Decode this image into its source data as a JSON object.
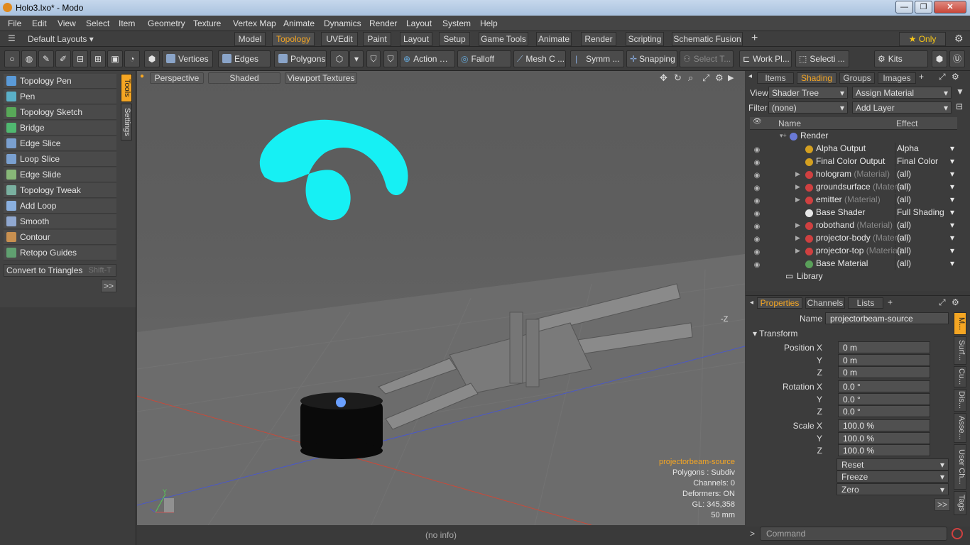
{
  "window": {
    "title": "Holo3.lxo* - Modo"
  },
  "menu": [
    "File",
    "Edit",
    "View",
    "Select",
    "Item",
    "Geometry",
    "Texture",
    "Vertex Map",
    "Animate",
    "Dynamics",
    "Render",
    "Layout",
    "System",
    "Help"
  ],
  "layouts": {
    "default": "Default Layouts ▾",
    "tabs": [
      "Model",
      "Topology",
      "UVEdit",
      "Paint",
      "Layout",
      "Setup",
      "Game Tools",
      "Animate",
      "Render",
      "Scripting",
      "Schematic Fusion"
    ],
    "active": "Topology",
    "only": "★ Only"
  },
  "toolbar": {
    "vertices": "Vertices",
    "edges": "Edges",
    "polygons": "Polygons",
    "action": "Action",
    "falloff": "Falloff",
    "meshc": "Mesh C ...",
    "symm": "Symm ...",
    "snapping": "Snapping",
    "selectt": "Select T...",
    "workpl": "Work Pl...",
    "selecti": "Selecti ...",
    "kits": "Kits"
  },
  "tools": [
    "Topology Pen",
    "Pen",
    "Topology Sketch",
    "Bridge",
    "Edge Slice",
    "Loop Slice",
    "Edge Slide",
    "Topology Tweak",
    "Add Loop",
    "Smooth",
    "Contour",
    "Retopo Guides"
  ],
  "tools_extra": {
    "convert": "Convert to Triangles",
    "shortcut": "Shift-T",
    "more": ">>"
  },
  "vtabs": {
    "tools": "Tools",
    "settings": "Settings"
  },
  "viewport": {
    "perspective": "Perspective",
    "shaded": "Shaded",
    "textures": "Viewport Textures",
    "axis": "-Z",
    "info": [
      "projectorbeam-source",
      "Polygons : Subdiv",
      "Channels: 0",
      "Deformers: ON",
      "GL: 345,358",
      "50 mm"
    ],
    "status": "(no info)",
    "gizmo_y": "Y"
  },
  "shading": {
    "tabs": [
      "Items",
      "Shading",
      "Groups",
      "Images"
    ],
    "active": "Shading",
    "view_label": "View",
    "view_value": "Shader Tree",
    "assign": "Assign Material",
    "filter_label": "Filter",
    "filter_value": "(none)",
    "addlayer": "Add Layer",
    "col_name": "Name",
    "col_effect": "Effect",
    "rows": [
      {
        "name": "Render",
        "sub": "",
        "effect": "",
        "ball": "#6a7ad8",
        "indent": 56
      },
      {
        "name": "Alpha Output",
        "sub": "",
        "effect": "Alpha",
        "ball": "#d4a020",
        "indent": 78
      },
      {
        "name": "Final Color Output",
        "sub": "",
        "effect": "Final Color",
        "ball": "#d4a020",
        "indent": 78
      },
      {
        "name": "hologram",
        "sub": " (Material)",
        "effect": "(all)",
        "ball": "#d04040",
        "indent": 78
      },
      {
        "name": "groundsurface",
        "sub": " (Material)",
        "effect": "(all)",
        "ball": "#d04040",
        "indent": 78
      },
      {
        "name": "emitter",
        "sub": " (Material)",
        "effect": "(all)",
        "ball": "#d04040",
        "indent": 78
      },
      {
        "name": "Base Shader",
        "sub": "",
        "effect": "Full Shading",
        "ball": "#e8e8e8",
        "indent": 78
      },
      {
        "name": "robothand",
        "sub": " (Material)",
        "effect": "(all)",
        "ball": "#d04040",
        "indent": 78
      },
      {
        "name": "projector-body",
        "sub": " (Material)",
        "effect": "(all)",
        "ball": "#d04040",
        "indent": 78
      },
      {
        "name": "projector-top",
        "sub": " (Material)",
        "effect": "(all)",
        "ball": "#d04040",
        "indent": 78
      },
      {
        "name": "Base Material",
        "sub": "",
        "effect": "(all)",
        "ball": "#5aa05a",
        "indent": 78
      }
    ],
    "library": "Library"
  },
  "properties": {
    "tabs": [
      "Properties",
      "Channels",
      "Lists"
    ],
    "active": "Properties",
    "name_label": "Name",
    "name_value": "projectorbeam-source",
    "transform": "Transform",
    "fields": [
      {
        "label": "Position X",
        "value": "0 m"
      },
      {
        "label": "Y",
        "value": "0 m"
      },
      {
        "label": "Z",
        "value": "0 m"
      },
      {
        "label": "Rotation X",
        "value": "0.0 °"
      },
      {
        "label": "Y",
        "value": "0.0 °"
      },
      {
        "label": "Z",
        "value": "0.0 °"
      },
      {
        "label": "Scale X",
        "value": "100.0 %"
      },
      {
        "label": "Y",
        "value": "100.0 %"
      },
      {
        "label": "Z",
        "value": "100.0 %"
      }
    ],
    "buttons": [
      "Reset",
      "Freeze",
      "Zero"
    ],
    "more": ">>",
    "sidetabs": [
      "M...",
      "Surf...",
      "Cu...",
      "Dis...",
      "Asse...",
      "User Ch...",
      "Tags"
    ]
  },
  "command": {
    "placeholder": "Command",
    "arrow": ">"
  }
}
